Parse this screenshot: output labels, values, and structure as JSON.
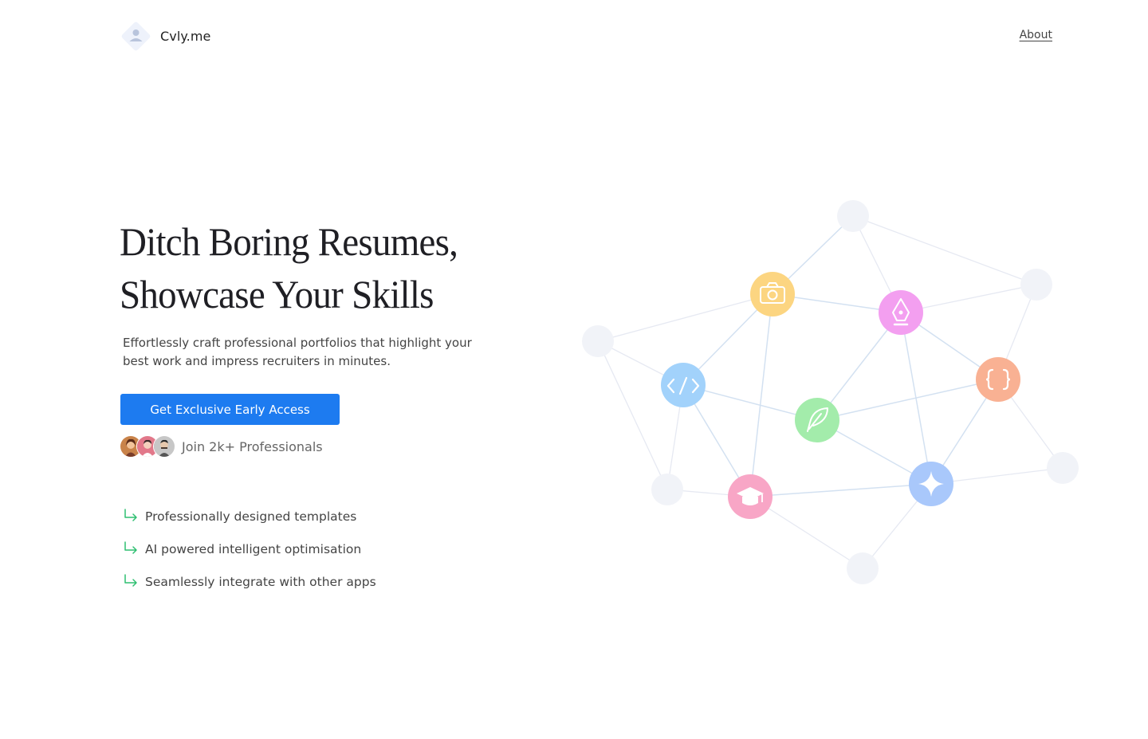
{
  "header": {
    "logo_text": "Cvly.me",
    "nav": {
      "about": "About"
    }
  },
  "hero": {
    "headline_line1": "Ditch Boring Resumes,",
    "headline_line2": "Showcase Your Skills",
    "subtext": "Effortlessly craft professional portfolios that highlight your best work and impress recruiters in minutes.",
    "cta_label": "Get Exclusive Early Access",
    "social_proof": "Join 2k+ Professionals"
  },
  "features": [
    {
      "label": "Professionally designed templates"
    },
    {
      "label": "AI powered intelligent optimisation"
    },
    {
      "label": "Seamlessly integrate with other apps"
    }
  ],
  "colors": {
    "accent": "#1d7bf0",
    "feature_arrow": "#2fbf71",
    "camera": "#fcd581",
    "pen": "#f39ff0",
    "code": "#a2d2fb",
    "braces": "#f9b193",
    "feather": "#a3ecab",
    "graduation": "#f8a6c6",
    "sparkle": "#a9c8fb"
  },
  "network_icons": [
    "camera-icon",
    "pen-nib-icon",
    "code-icon",
    "braces-icon",
    "feather-icon",
    "graduation-cap-icon",
    "sparkle-icon"
  ]
}
